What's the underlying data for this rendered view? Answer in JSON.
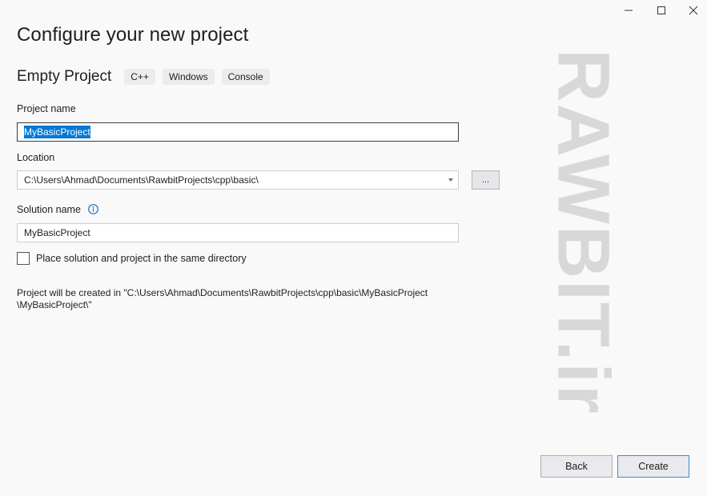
{
  "window": {
    "controls": [
      "minimize-icon",
      "maximize-icon",
      "close-icon"
    ]
  },
  "header": {
    "title": "Configure your new project",
    "template_name": "Empty Project",
    "tags": [
      "C++",
      "Windows",
      "Console"
    ]
  },
  "form": {
    "project_name_label": "Project name",
    "project_name_value": "MyBasicProject",
    "location_label": "Location",
    "location_value": "C:\\Users\\Ahmad\\Documents\\RawbitProjects\\cpp\\basic\\",
    "browse_label": "...",
    "solution_name_label": "Solution name",
    "solution_name_value": "MyBasicProject",
    "same_directory_label": "Place solution and project in the same directory",
    "same_directory_checked": false,
    "info_line1": "Project will be created in \"C:\\Users\\Ahmad\\Documents\\RawbitProjects\\cpp\\basic\\MyBasicProject",
    "info_line2": "\\MyBasicProject\\\""
  },
  "watermark": "RAWBIT.ir",
  "footer": {
    "back_label": "Back",
    "create_label": "Create"
  },
  "colors": {
    "selection": "#0078d7",
    "primary_border": "#3c8bd6",
    "info_icon": "#1a73c8"
  }
}
